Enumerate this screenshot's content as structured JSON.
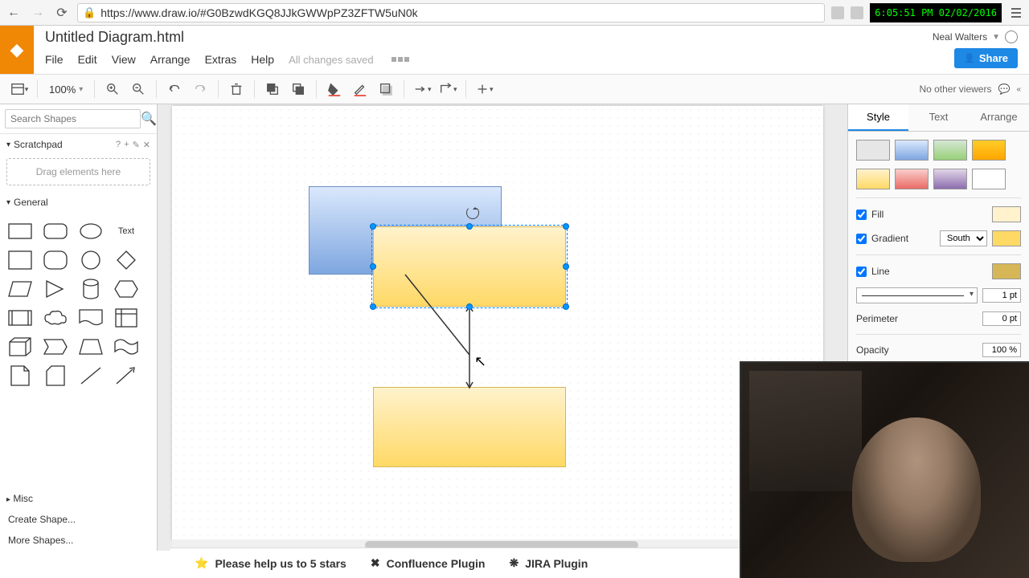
{
  "browser": {
    "url": "https://www.draw.io/#G0BzwdKGQ8JJkGWWpPZ3ZFTW5uN0k",
    "clock": "6:05:51 PM 02/02/2016"
  },
  "header": {
    "title": "Untitled Diagram.html",
    "user": "Neal Walters",
    "share": "Share",
    "menus": [
      "File",
      "Edit",
      "View",
      "Arrange",
      "Extras",
      "Help"
    ],
    "saved": "All changes saved"
  },
  "toolbar": {
    "zoom": "100%",
    "viewers": "No other viewers"
  },
  "sidebar": {
    "search_placeholder": "Search Shapes",
    "scratchpad": "Scratchpad",
    "scratch_hint": "Drag elements here",
    "general": "General",
    "text_label": "Text",
    "misc": "Misc",
    "create": "Create Shape...",
    "more": "More Shapes..."
  },
  "panel": {
    "tabs": [
      "Style",
      "Text",
      "Arrange"
    ],
    "fill": "Fill",
    "gradient": "Gradient",
    "gradient_dir": "South",
    "line": "Line",
    "line_width": "1 pt",
    "perimeter": "Perimeter",
    "perimeter_val": "0 pt",
    "opacity": "Opacity",
    "opacity_val": "100 %",
    "colors": {
      "fill": "#fff2cc",
      "gradient": "#ffd966",
      "line": "#d6b656"
    },
    "swatches1": [
      "#e6e6e6",
      "#a9c4eb",
      "#b0e3a3",
      "#f8c471"
    ],
    "swatches2": [
      "#fdebd0",
      "#f1948a",
      "#c39bd3",
      "#ffffff"
    ]
  },
  "bottom": {
    "stars": "Please help us to 5 stars",
    "confluence": "Confluence Plugin",
    "jira": "JIRA Plugin"
  }
}
